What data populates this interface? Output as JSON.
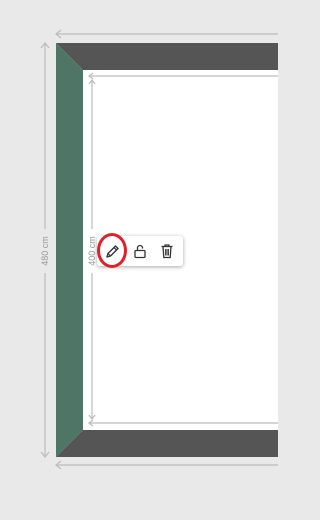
{
  "dimensions": {
    "outer_height_label": "480 cm",
    "inner_height_label": "400 cm"
  },
  "toolbar": {
    "edit_icon": "pencil-icon",
    "lock_icon": "unlock-icon",
    "delete_icon": "trash-icon",
    "highlight_color": "#e0202a"
  },
  "colors": {
    "background": "#e9e9e9",
    "left_wall": "#4e7566",
    "top_bottom_wall": "#555555",
    "room_floor": "#ffffff",
    "dimension_lines": "#bcbcbc"
  }
}
